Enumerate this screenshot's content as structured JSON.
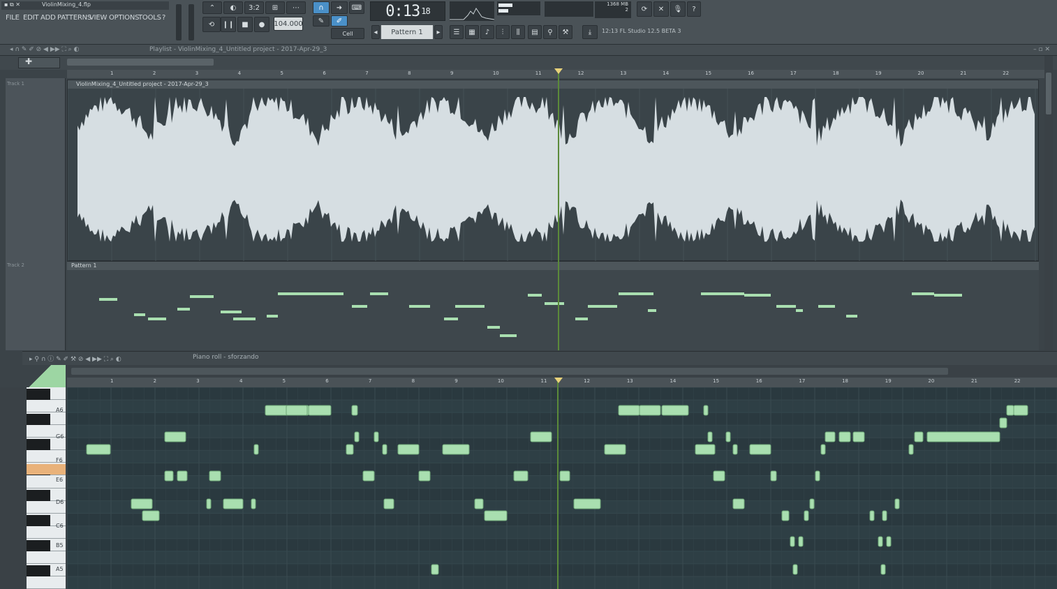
{
  "window": {
    "title": "ViolinMixing_4.flp"
  },
  "menu": {
    "items": [
      "FILE",
      "EDIT",
      "ADD",
      "PATTERNS",
      "VIEW",
      "OPTIONS",
      "TOOLS",
      "?"
    ]
  },
  "transport": {
    "time": "0:13",
    "time_frac": "18",
    "tempo": "104.000",
    "pattern": "Pattern 1",
    "snap": "Cell",
    "cpu": "1368 MB",
    "cpu2": "2",
    "hint": "12:13  FL Studio 12.5 BETA 3"
  },
  "playlist": {
    "title": "Playlist - ViolinMixing_4_Untitled project - 2017-Apr-29_3",
    "audio_clip": "ViolinMixing_4_Untitled project - 2017-Apr-29_3",
    "pattern_clip": "Pattern 1",
    "track1": "Track 1",
    "track2": "Track 2",
    "ruler": [
      "1",
      "2",
      "3",
      "4",
      "5",
      "6",
      "7",
      "8",
      "9",
      "10",
      "11",
      "12",
      "13",
      "14",
      "15",
      "16",
      "17",
      "18",
      "19",
      "20",
      "21",
      "22",
      "23"
    ]
  },
  "piano_roll": {
    "title": "Piano roll - sforzando",
    "note_rows": [
      "A6",
      "G6",
      "F6",
      "E6",
      "D6",
      "C6",
      "B5",
      "A5"
    ],
    "ruler": [
      "1",
      "2",
      "3",
      "4",
      "5",
      "6",
      "7",
      "8",
      "9",
      "10",
      "11",
      "12",
      "13",
      "14",
      "15",
      "16",
      "17",
      "18",
      "19",
      "20",
      "21",
      "22",
      "23"
    ],
    "accent": "#a9dfb0",
    "playhead_color": "#5b8a3a"
  },
  "colors": {
    "waveform": "#d6dee2",
    "bg": "#3b4348",
    "note": "#a9dfb0"
  }
}
